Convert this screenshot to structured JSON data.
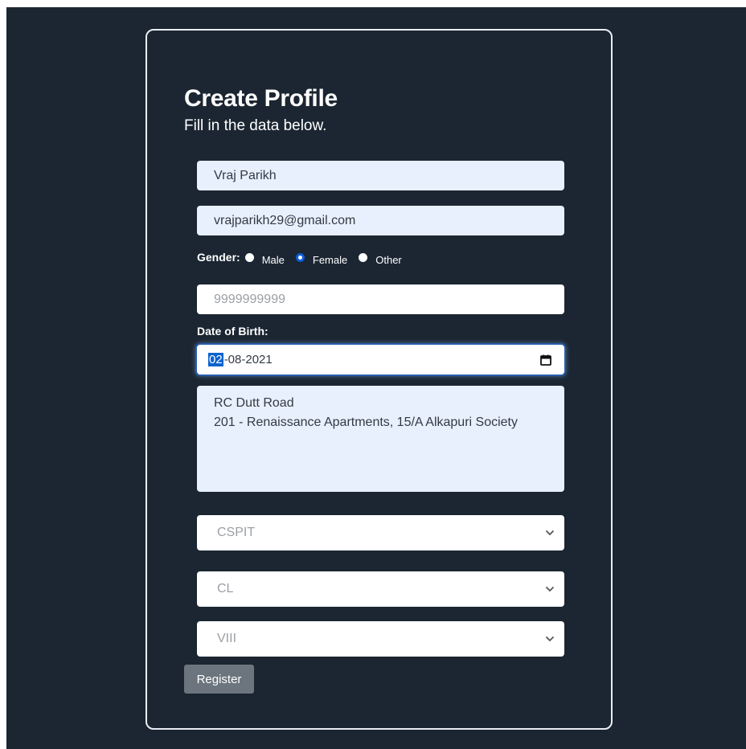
{
  "form": {
    "title": "Create Profile",
    "subtitle": "Fill in the data below.",
    "name_value": "Vraj Parikh",
    "email_value": "vrajparikh29@gmail.com",
    "gender": {
      "label": "Gender:",
      "options": [
        "Male",
        "Female",
        "Other"
      ],
      "selected": "Female"
    },
    "phone_placeholder": "9999999999",
    "dob": {
      "label": "Date of Birth:",
      "day": "02",
      "rest": "-08-2021"
    },
    "address_line1": "RC Dutt Road",
    "address_line2": "201 - Renaissance Apartments, 15/A Alkapuri Society",
    "institute": "CSPIT",
    "department": "CL",
    "semester": "VIII",
    "register_label": "Register"
  },
  "colors": {
    "background": "#1b2632",
    "autofill": "#e8f0fe",
    "accent": "#0b5ed7",
    "button": "#6c757d"
  },
  "icons": {
    "date": "calendar-icon",
    "select": "chevron-down-icon"
  }
}
